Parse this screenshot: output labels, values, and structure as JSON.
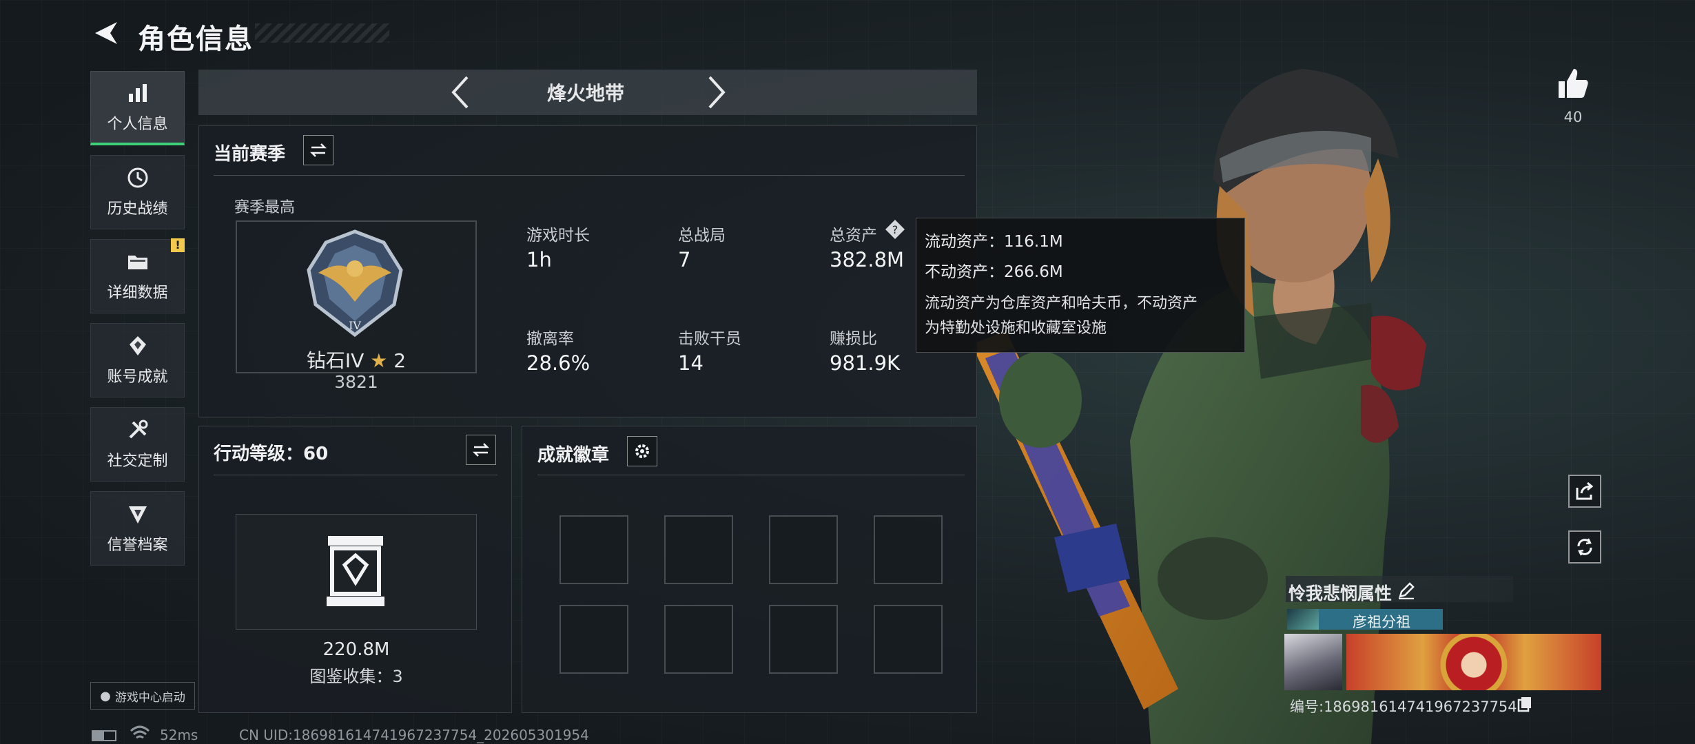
{
  "header": {
    "title": "角色信息"
  },
  "nav": {
    "items": [
      {
        "label": "个人信息",
        "icon": "bar-chart-icon"
      },
      {
        "label": "历史战绩",
        "icon": "history-icon"
      },
      {
        "label": "详细数据",
        "icon": "folder-icon",
        "badge": "!"
      },
      {
        "label": "账号成就",
        "icon": "achievement-icon"
      },
      {
        "label": "社交定制",
        "icon": "tools-icon"
      },
      {
        "label": "信誉档案",
        "icon": "shield-icon"
      }
    ],
    "launch_label": "游戏中心启动"
  },
  "mode": {
    "label": "烽火地带"
  },
  "season": {
    "title": "当前赛季",
    "best_label": "赛季最高",
    "rank_name": "钻石IV",
    "rank_stars": "2",
    "rank_score": "3821",
    "stats": [
      {
        "label": "游戏时长",
        "value": "1h"
      },
      {
        "label": "总战局",
        "value": "7"
      },
      {
        "label": "总资产",
        "value": "382.8M"
      },
      {
        "label": "撤离率",
        "value": "28.6%"
      },
      {
        "label": "击败干员",
        "value": "14"
      },
      {
        "label": "赚损比",
        "value": "981.9K"
      }
    ]
  },
  "tooltip": {
    "liquid": "流动资产：116.1M",
    "fixed": "不动资产：266.6M",
    "desc_1": "流动资产为仓库资产和哈夫币，不动资产",
    "desc_2": "为特勤处设施和收藏室设施"
  },
  "action_level": {
    "title": "行动等级：60",
    "collection_value": "220.8M",
    "collection_label": "图鉴收集：3"
  },
  "badges": {
    "title": "成就徽章",
    "slot_count": 8
  },
  "player": {
    "likes": "40",
    "name": "怜我悲悯属性",
    "team": "彦祖分祖",
    "id_label": "编号:186981614741967237754"
  },
  "footer": {
    "ping": "52ms",
    "uid": "CN UID:186981614741967237754_202605301954"
  },
  "colors": {
    "accent": "#3ecf7a",
    "badge": "#f2c94c"
  }
}
